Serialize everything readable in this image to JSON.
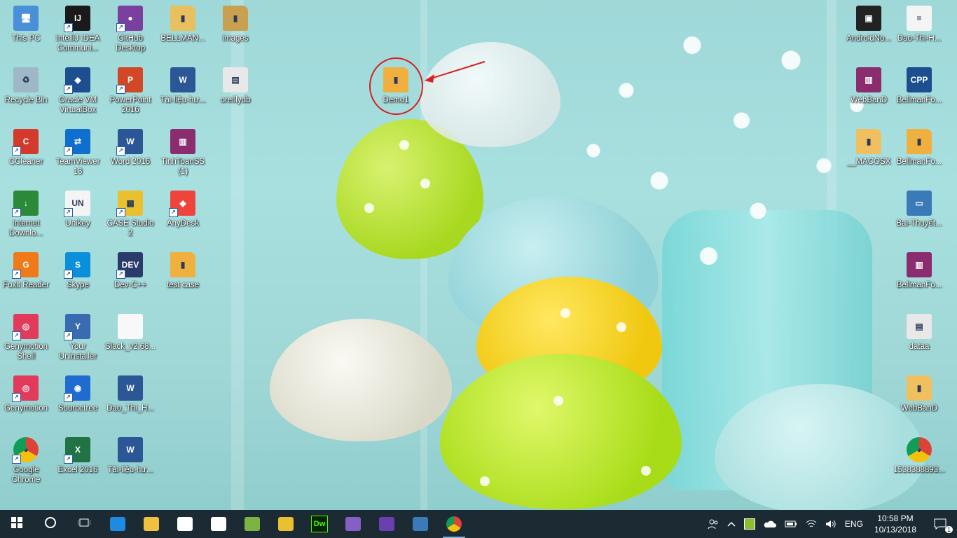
{
  "desktop_icons": [
    {
      "label": "This PC",
      "icon": "this-pc-icon",
      "color": "#4a90d9",
      "glyph": "🖥"
    },
    {
      "label": "IntelliJ IDEA Communi...",
      "icon": "intellij-icon",
      "color": "#1a1a1a",
      "glyph": "IJ"
    },
    {
      "label": "GitHub Desktop",
      "icon": "github-desktop-icon",
      "color": "#7b3fa0",
      "glyph": "●"
    },
    {
      "label": "BELLMAN...",
      "icon": "folder-icon",
      "color": "#e8c060",
      "glyph": "▮"
    },
    {
      "label": "images",
      "icon": "folder-icon",
      "color": "#c9a050",
      "glyph": "▮"
    },
    {
      "label": "Recycle Bin",
      "icon": "recycle-bin-icon",
      "color": "#9fb8c8",
      "glyph": "♻"
    },
    {
      "label": "Oracle VM VirtualBox",
      "icon": "virtualbox-icon",
      "color": "#1d4e8f",
      "glyph": "◆"
    },
    {
      "label": "PowerPoint 2016",
      "icon": "powerpoint-icon",
      "color": "#d24726",
      "glyph": "P"
    },
    {
      "label": "Tài-liệu-hư...",
      "icon": "word-doc-icon",
      "color": "#2b5797",
      "glyph": "W"
    },
    {
      "label": "oreillydb",
      "icon": "database-file-icon",
      "color": "#e8e8e8",
      "glyph": "▤"
    },
    {
      "label": "CCleaner",
      "icon": "ccleaner-icon",
      "color": "#d33a2c",
      "glyph": "C"
    },
    {
      "label": "TeamViewer 13",
      "icon": "teamviewer-icon",
      "color": "#0e6fcf",
      "glyph": "⇄"
    },
    {
      "label": "Word 2016",
      "icon": "word-icon",
      "color": "#2b5797",
      "glyph": "W"
    },
    {
      "label": "TinhToanSS (1)",
      "icon": "winrar-icon",
      "color": "#8a2c6e",
      "glyph": "▥"
    },
    {
      "label": "Internet Downlo...",
      "icon": "idm-icon",
      "color": "#2a8a3a",
      "glyph": "↓"
    },
    {
      "label": "Unikey",
      "icon": "unikey-icon",
      "color": "#f4f4f4",
      "glyph": "UN"
    },
    {
      "label": "CASE Studio 2",
      "icon": "case-studio-icon",
      "color": "#e8c030",
      "glyph": "▦"
    },
    {
      "label": "AnyDesk",
      "icon": "anydesk-icon",
      "color": "#ef443b",
      "glyph": "◆"
    },
    {
      "label": "Foxit Reader",
      "icon": "foxit-icon",
      "color": "#f07a1a",
      "glyph": "G"
    },
    {
      "label": "Skype",
      "icon": "skype-icon",
      "color": "#0a8fdb",
      "glyph": "S"
    },
    {
      "label": "Dev-C++",
      "icon": "dev-cpp-icon",
      "color": "#2a3a6a",
      "glyph": "DEV"
    },
    {
      "label": "test case",
      "icon": "folder-icon",
      "color": "#f0b040",
      "glyph": "▮"
    },
    {
      "label": "Genymotion Shell",
      "icon": "genymotion-shell-icon",
      "color": "#e23a5a",
      "glyph": "◎"
    },
    {
      "label": "Your Uninstaller",
      "icon": "uninstaller-icon",
      "color": "#3a6ab0",
      "glyph": "Y"
    },
    {
      "label": "Slack_v2.68...",
      "icon": "blank-file-icon",
      "color": "#f8f8f8",
      "glyph": ""
    },
    {
      "label": "Genymotion",
      "icon": "genymotion-icon",
      "color": "#e23a5a",
      "glyph": "◎"
    },
    {
      "label": "Sourcetree",
      "icon": "sourcetree-icon",
      "color": "#1f6bcf",
      "glyph": "◉"
    },
    {
      "label": "Dao_Thi_H...",
      "icon": "word-doc-icon",
      "color": "#2b5797",
      "glyph": "W"
    },
    {
      "label": "Google Chrome",
      "icon": "chrome-icon",
      "color": "#ffffff",
      "glyph": "◕"
    },
    {
      "label": "Excel 2016",
      "icon": "excel-icon",
      "color": "#217346",
      "glyph": "X"
    },
    {
      "label": "Tài-liệu-hư...",
      "icon": "word-doc-icon",
      "color": "#2b5797",
      "glyph": "W"
    },
    {
      "label": "Demo1",
      "icon": "folder-icon",
      "color": "#f0b040",
      "glyph": "▮"
    },
    {
      "label": "AndroidNo...",
      "icon": "android-notes-icon",
      "color": "#222222",
      "glyph": "▣"
    },
    {
      "label": "Dao-Thi-H...",
      "icon": "document-icon",
      "color": "#f4f4f4",
      "glyph": "≡"
    },
    {
      "label": "WebBanD",
      "icon": "winrar-icon",
      "color": "#8a2c6e",
      "glyph": "▥"
    },
    {
      "label": "BellmanFo...",
      "icon": "cpp-file-icon",
      "color": "#1d4e8f",
      "glyph": "CPP"
    },
    {
      "label": "__MACOSX",
      "icon": "folder-icon",
      "color": "#f0c060",
      "glyph": "▮"
    },
    {
      "label": "BellmanFo...",
      "icon": "folder-icon",
      "color": "#f0b040",
      "glyph": "▮"
    },
    {
      "label": "Bai-Thuyết...",
      "icon": "image-file-icon",
      "color": "#3a7ab8",
      "glyph": "▭"
    },
    {
      "label": "BellmanFo...",
      "icon": "winrar-icon",
      "color": "#8a2c6e",
      "glyph": "▥"
    },
    {
      "label": "dataa",
      "icon": "data-file-icon",
      "color": "#e8e8e8",
      "glyph": "▤"
    },
    {
      "label": "WebBanD",
      "icon": "zip-folder-icon",
      "color": "#f0c060",
      "glyph": "▮"
    },
    {
      "label": "1538388893...",
      "icon": "chrome-icon",
      "color": "#ffffff",
      "glyph": "◕"
    }
  ],
  "taskbar": {
    "apps": [
      {
        "name": "start",
        "icon": "windows-start-icon"
      },
      {
        "name": "search",
        "icon": "cortana-circle-icon"
      },
      {
        "name": "task-view",
        "icon": "task-view-icon"
      },
      {
        "name": "edge",
        "icon": "edge-icon"
      },
      {
        "name": "file-explorer",
        "icon": "file-explorer-icon"
      },
      {
        "name": "store",
        "icon": "store-icon"
      },
      {
        "name": "mail",
        "icon": "mail-icon"
      },
      {
        "name": "android-studio",
        "icon": "android-studio-icon"
      },
      {
        "name": "tools",
        "icon": "tools-icon"
      },
      {
        "name": "dreamweaver",
        "icon": "dreamweaver-icon",
        "text": "Dw"
      },
      {
        "name": "visual-studio",
        "icon": "visual-studio-icon"
      },
      {
        "name": "eclipse",
        "icon": "eclipse-icon"
      },
      {
        "name": "mysql-workbench",
        "icon": "mysql-workbench-icon"
      },
      {
        "name": "chrome",
        "icon": "chrome-icon"
      }
    ],
    "tray": {
      "language": "ENG",
      "time": "10:58 PM",
      "date": "10/13/2018",
      "notification_count": "1"
    }
  }
}
